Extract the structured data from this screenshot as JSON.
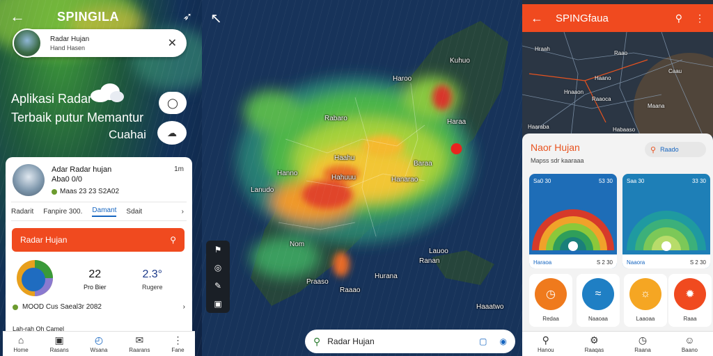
{
  "left": {
    "title": "SPINGILA",
    "location": {
      "line1": "Radar Hujan",
      "line2": "Hand Hasen"
    },
    "hero": {
      "line1": "Aplikasi Radar",
      "line2": "Terbaik putur Memantur",
      "line3": "Cuahai"
    },
    "card": {
      "line1": "Adar Radar hujan",
      "line2": "Aba0 0/0",
      "line3": "Maas 23 23 S2A02",
      "time": "1m",
      "tabs": [
        "Radarit",
        "Fanpire 300.",
        "Damant",
        "Sdait"
      ],
      "active_tab": 2,
      "button_label": "Radar Hujan",
      "stat1_value": "22",
      "stat1_label": "Pro Bier",
      "stat2_value": "2.3°",
      "stat2_label": "Rugere",
      "row1": "MOOD Cus Saeal3r 2082",
      "row2": "Lah-rah Oh Camel"
    },
    "nav": [
      "Home",
      "Rasans",
      "Wsana",
      "Raarans",
      "Fane"
    ]
  },
  "map": {
    "labels": [
      "Kuhuo",
      "Haroo",
      "Rabaro",
      "Haraa",
      "Haahu",
      "Baraa",
      "Hanno",
      "Hanarao",
      "Hahuuu",
      "Nom",
      "Lauoo",
      "Ranan",
      "Hurana",
      "Praaso",
      "Raaao",
      "Lanudo",
      "Haaatwo"
    ],
    "search_label": "Radar Hujan"
  },
  "right": {
    "title": "SPINGfaua",
    "labels": [
      "Hraah",
      "Raao",
      "Caau",
      "Haano",
      "Hnaaon",
      "Raaoca",
      "Maana",
      "Haaraba",
      "Habaaso"
    ],
    "card_title": "Naor Hujan",
    "card_sub": "Mapss sdr kaaraaa",
    "search": "Raado",
    "gauge1": {
      "head_left": "Sa0 30",
      "head_right": "53 30",
      "foot_left": "Haraoa",
      "foot_right": "S 2 30"
    },
    "gauge2": {
      "head_left": "Saa 30",
      "head_right": "33 30",
      "foot_left": "Naaora",
      "foot_right": "S 2 30"
    },
    "icons": [
      {
        "label": "Redaa",
        "color": "#ef7a1d"
      },
      {
        "label": "Naaoaa",
        "color": "#1f7fc4"
      },
      {
        "label": "Laaoaa",
        "color": "#f5a623"
      },
      {
        "label": "Raaa",
        "color": "#f04a1f"
      }
    ],
    "nav": [
      "Hanou",
      "Raaqas",
      "Raana",
      "Baano"
    ]
  },
  "colors": {
    "accent": "#f04a1f",
    "link": "#1565c0"
  }
}
